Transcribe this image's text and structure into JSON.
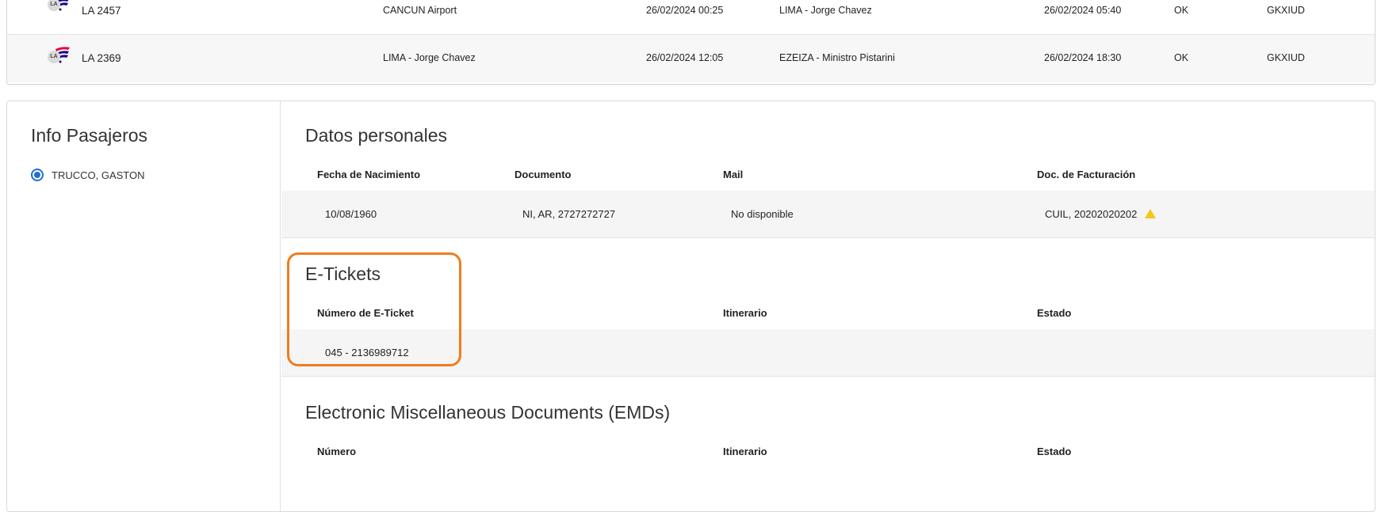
{
  "flights": {
    "rows": [
      {
        "airline": "LA",
        "flight": "LA 2457",
        "origin": "CANCUN Airport",
        "departure": "26/02/2024 00:25",
        "destination": "LIMA - Jorge Chavez",
        "arrival": "26/02/2024 05:40",
        "status": "OK",
        "pnr": "GKXIUD"
      },
      {
        "airline": "LA",
        "flight": "LA 2369",
        "origin": "LIMA - Jorge Chavez",
        "departure": "26/02/2024 12:05",
        "destination": "EZEIZA - Ministro Pistarini",
        "arrival": "26/02/2024 18:30",
        "status": "OK",
        "pnr": "GKXIUD"
      }
    ]
  },
  "passengers": {
    "title": "Info Pasajeros",
    "selected": "TRUCCO, GASTON"
  },
  "personal": {
    "title": "Datos personales",
    "headers": {
      "birth": "Fecha de Nacimiento",
      "document": "Documento",
      "mail": "Mail",
      "billing": "Doc. de Facturación"
    },
    "values": {
      "birth": "10/08/1960",
      "document": "NI, AR, 2727272727",
      "mail": "No disponible",
      "billing": "CUIL, 20202020202"
    }
  },
  "etickets": {
    "title": "E-Tickets",
    "headers": {
      "number": "Número de E-Ticket",
      "itinerary": "Itinerario",
      "status": "Estado"
    },
    "values": {
      "number": "045 - 2136989712"
    }
  },
  "emds": {
    "title": "Electronic Miscellaneous Documents (EMDs)",
    "headers": {
      "number": "Número",
      "itinerary": "Itinerario",
      "status": "Estado"
    }
  },
  "colors": {
    "accent": "#1f6fd6",
    "highlight": "#f07c1e",
    "warning": "#f5c518"
  }
}
